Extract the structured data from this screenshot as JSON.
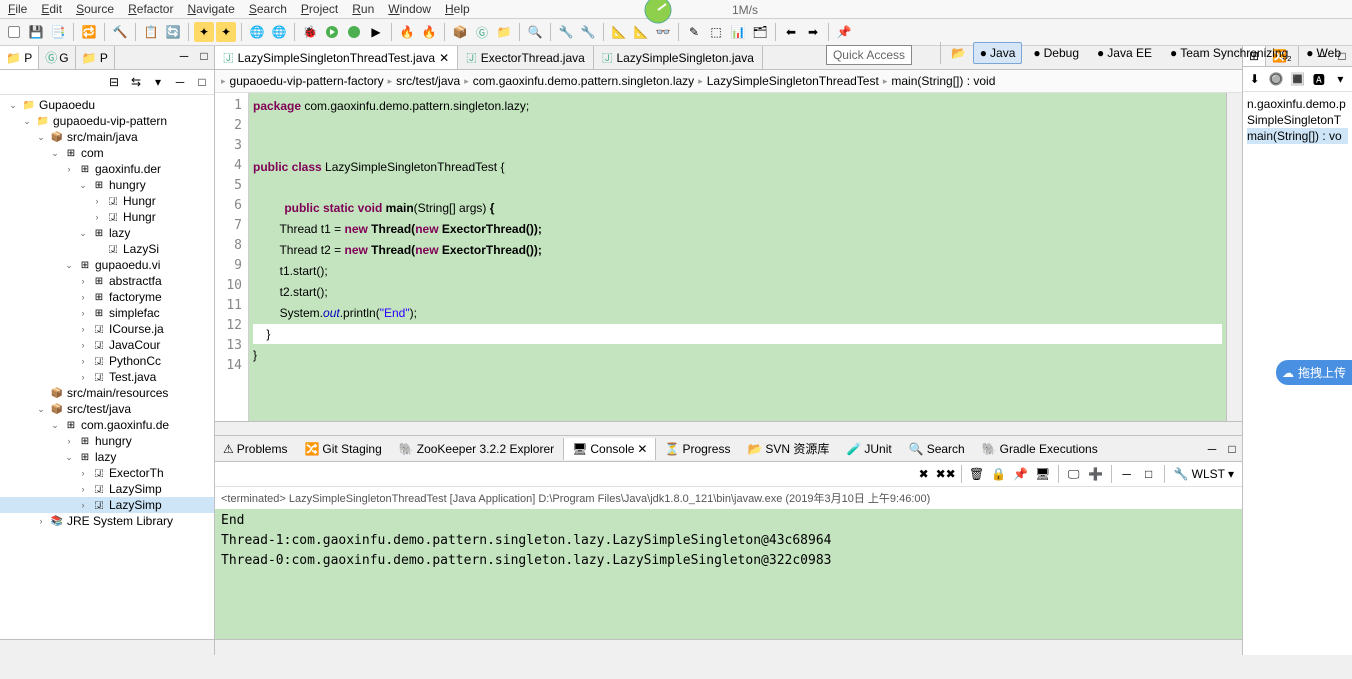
{
  "menu": [
    "File",
    "Edit",
    "Source",
    "Refactor",
    "Navigate",
    "Search",
    "Project",
    "Run",
    "Window",
    "Help"
  ],
  "speed": "1M/s",
  "quickAccess": "Quick Access",
  "perspectives": [
    {
      "label": "Java",
      "active": true
    },
    {
      "label": "Debug",
      "active": false
    },
    {
      "label": "Java EE",
      "active": false
    },
    {
      "label": "Team Synchronizing",
      "active": false
    },
    {
      "label": "Web",
      "active": false
    }
  ],
  "leftTabs": [
    "P",
    "G",
    "P"
  ],
  "tree": [
    {
      "indent": 0,
      "arrow": "v",
      "icon": "project",
      "label": "Gupaoedu"
    },
    {
      "indent": 1,
      "arrow": "v",
      "icon": "project",
      "label": "gupaoedu-vip-pattern"
    },
    {
      "indent": 2,
      "arrow": "v",
      "icon": "src",
      "label": "src/main/java"
    },
    {
      "indent": 3,
      "arrow": "v",
      "icon": "pkg",
      "label": "com"
    },
    {
      "indent": 4,
      "arrow": ">",
      "icon": "pkg",
      "label": "gaoxinfu.der"
    },
    {
      "indent": 5,
      "arrow": "v",
      "icon": "pkg",
      "label": "hungry"
    },
    {
      "indent": 6,
      "arrow": ">",
      "icon": "java",
      "label": "Hungr"
    },
    {
      "indent": 6,
      "arrow": ">",
      "icon": "java",
      "label": "Hungr"
    },
    {
      "indent": 5,
      "arrow": "v",
      "icon": "pkg",
      "label": "lazy"
    },
    {
      "indent": 6,
      "arrow": "",
      "icon": "java",
      "label": "LazySi"
    },
    {
      "indent": 4,
      "arrow": "v",
      "icon": "pkg",
      "label": "gupaoedu.vi"
    },
    {
      "indent": 5,
      "arrow": ">",
      "icon": "pkg",
      "label": "abstractfa"
    },
    {
      "indent": 5,
      "arrow": ">",
      "icon": "pkg",
      "label": "factoryme"
    },
    {
      "indent": 5,
      "arrow": ">",
      "icon": "pkg",
      "label": "simplefac"
    },
    {
      "indent": 5,
      "arrow": ">",
      "icon": "java",
      "label": "ICourse.ja"
    },
    {
      "indent": 5,
      "arrow": ">",
      "icon": "java",
      "label": "JavaCour"
    },
    {
      "indent": 5,
      "arrow": ">",
      "icon": "java",
      "label": "PythonCc"
    },
    {
      "indent": 5,
      "arrow": ">",
      "icon": "java",
      "label": "Test.java"
    },
    {
      "indent": 2,
      "arrow": "",
      "icon": "src",
      "label": "src/main/resources"
    },
    {
      "indent": 2,
      "arrow": "v",
      "icon": "src",
      "label": "src/test/java"
    },
    {
      "indent": 3,
      "arrow": "v",
      "icon": "pkg",
      "label": "com.gaoxinfu.de"
    },
    {
      "indent": 4,
      "arrow": ">",
      "icon": "pkg",
      "label": "hungry"
    },
    {
      "indent": 4,
      "arrow": "v",
      "icon": "pkg",
      "label": "lazy"
    },
    {
      "indent": 5,
      "arrow": ">",
      "icon": "java",
      "label": "ExectorTh"
    },
    {
      "indent": 5,
      "arrow": ">",
      "icon": "java",
      "label": "LazySimp"
    },
    {
      "indent": 5,
      "arrow": ">",
      "icon": "java",
      "label": "LazySimp",
      "selected": true
    },
    {
      "indent": 2,
      "arrow": ">",
      "icon": "lib",
      "label": "JRE System Library"
    }
  ],
  "editorTabs": [
    {
      "label": "LazySimpleSingletonThreadTest.java",
      "active": true,
      "closable": true
    },
    {
      "label": "ExectorThread.java",
      "active": false
    },
    {
      "label": "LazySimpleSingleton.java",
      "active": false
    }
  ],
  "breadcrumb": [
    "gupaoedu-vip-pattern-factory",
    "src/test/java",
    "com.gaoxinfu.demo.pattern.singleton.lazy",
    "LazySimpleSingletonThreadTest",
    "main(String[]) : void"
  ],
  "code": {
    "lines": [
      1,
      2,
      3,
      4,
      5,
      6,
      7,
      8,
      9,
      10,
      11,
      12,
      13,
      14
    ],
    "l1_a": "package",
    "l1_b": " com.gaoxinfu.demo.pattern.singleton.lazy;",
    "l4_a": "public class",
    "l4_b": " LazySimpleSingletonThreadTest {",
    "l6_a": "public static void",
    "l6_b": " main",
    "l6_c": "(String[] args)",
    "l6_d": " {",
    "l7_a": "        Thread t1 = ",
    "l7_b": "new",
    "l7_c": " Thread(",
    "l7_d": "new",
    "l7_e": " ExectorThread());",
    "l8_a": "        Thread t2 = ",
    "l8_b": "new",
    "l8_c": " Thread(",
    "l8_d": "new",
    "l8_e": " ExectorThread());",
    "l9": "        t1.start();",
    "l10": "        t2.start();",
    "l11_a": "        System.",
    "l11_b": "out",
    "l11_c": ".println(",
    "l11_d": "\"End\"",
    "l11_e": ");",
    "l12": "    }",
    "l13": "}"
  },
  "bottomTabs": [
    "Problems",
    "Git Staging",
    "ZooKeeper 3.2.2 Explorer",
    "Console",
    "Progress",
    "SVN 资源库",
    "JUnit",
    "Search",
    "Gradle Executions"
  ],
  "bottomActiveIdx": 3,
  "consoleHeader": "<terminated> LazySimpleSingletonThreadTest [Java Application] D:\\Program Files\\Java\\jdk1.8.0_121\\bin\\javaw.exe (2019年3月10日 上午9:46:00)",
  "consoleLines": [
    "End",
    "Thread-1:com.gaoxinfu.demo.pattern.singleton.lazy.LazySimpleSingleton@43c68964",
    "Thread-0:com.gaoxinfu.demo.pattern.singleton.lazy.LazySimpleSingleton@322c0983"
  ],
  "consoleDropdown": "WLST",
  "outline": [
    "n.gaoxinfu.demo.p",
    "SimpleSingletonT",
    "main(String[]) : vo"
  ],
  "floatBtn": "拖拽上传"
}
